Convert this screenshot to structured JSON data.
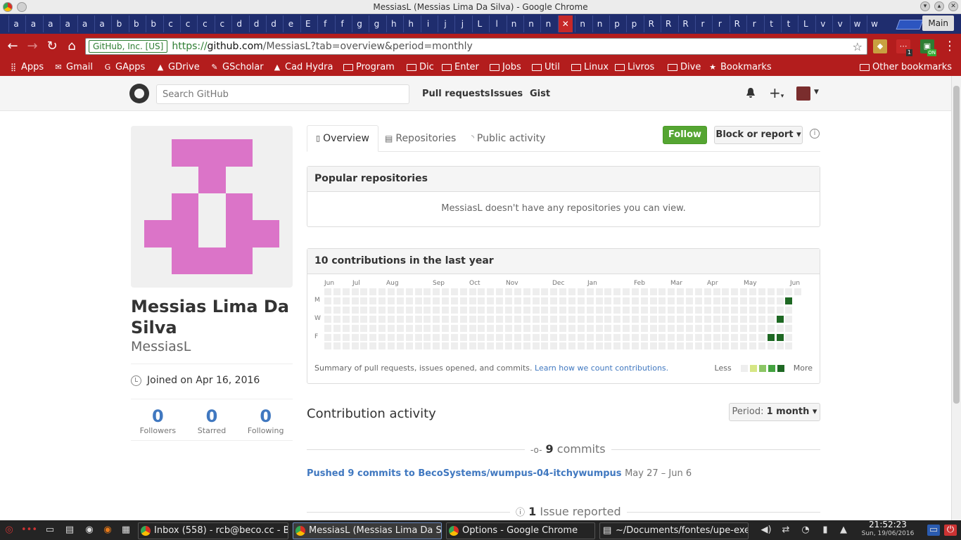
{
  "window": {
    "title": "MessiasL (Messias Lima Da Silva) - Google Chrome"
  },
  "tabstrip": {
    "tabs": [
      "a",
      "a",
      "a",
      "a",
      "a",
      "a",
      "b",
      "b",
      "b",
      "c",
      "c",
      "c",
      "c",
      "d",
      "d",
      "d",
      "e",
      "E",
      "f",
      "f",
      "g",
      "g",
      "h",
      "h",
      "i",
      "j",
      "j",
      "L",
      "l",
      "n",
      "n",
      "n",
      "✕",
      "n",
      "n",
      "p",
      "p",
      "R",
      "R",
      "R",
      "r",
      "r",
      "R",
      "r",
      "t",
      "t",
      "L",
      "v",
      "v",
      "w",
      "w"
    ],
    "active_index": 32,
    "profile": "Main"
  },
  "navbar": {
    "ev_badge": "GitHub, Inc. [US]",
    "url_scheme": "https://",
    "url_host": "github.com",
    "url_path": "/MessiasL?tab=overview&period=monthly",
    "ext_badges": [
      "1",
      "ON"
    ]
  },
  "bookmarks": [
    {
      "label": "Apps",
      "icon": "apps-grid-icon"
    },
    {
      "label": "Gmail",
      "icon": "gmail-icon"
    },
    {
      "label": "GApps",
      "icon": "google-icon"
    },
    {
      "label": "GDrive",
      "icon": "drive-icon"
    },
    {
      "label": "GScholar",
      "icon": "scholar-icon"
    },
    {
      "label": "Cad Hydra",
      "icon": "drive-icon"
    },
    {
      "label": "Program",
      "icon": "folder-icon"
    },
    {
      "label": "Dic",
      "icon": "folder-icon"
    },
    {
      "label": "Enter",
      "icon": "folder-icon"
    },
    {
      "label": "Jobs",
      "icon": "folder-icon"
    },
    {
      "label": "Util",
      "icon": "folder-icon"
    },
    {
      "label": "Linux",
      "icon": "folder-icon"
    },
    {
      "label": "Livros",
      "icon": "folder-icon"
    },
    {
      "label": "Dive",
      "icon": "folder-icon"
    },
    {
      "label": "Bookmarks",
      "icon": "star-icon"
    },
    {
      "label": "Other bookmarks",
      "icon": "folder-icon"
    }
  ],
  "github": {
    "search_placeholder": "Search GitHub",
    "nav": [
      "Pull requests",
      "Issues",
      "Gist"
    ],
    "profile": {
      "fullname": "Messias Lima Da Silva",
      "username": "MessiasL",
      "joined": "Joined on Apr 16, 2016",
      "stats": [
        {
          "num": "0",
          "label": "Followers"
        },
        {
          "num": "0",
          "label": "Starred"
        },
        {
          "num": "0",
          "label": "Following"
        }
      ],
      "identicon_color": "#db74c8"
    },
    "tabs": [
      "Overview",
      "Repositories",
      "Public activity"
    ],
    "follow": "Follow",
    "block": "Block or report ▾",
    "popular": {
      "title": "Popular repositories",
      "message": "MessiasL doesn't have any repositories you can view."
    },
    "contributions": {
      "title": "10 contributions in the last year",
      "months": [
        "Jun",
        "Jul",
        "Aug",
        "Sep",
        "Oct",
        "Nov",
        "Dec",
        "Jan",
        "Feb",
        "Mar",
        "Apr",
        "May",
        "Jun"
      ],
      "days": [
        "M",
        "W",
        "F"
      ],
      "summary": "Summary of pull requests, issues opened, and commits.",
      "learn_link": "Learn how we count contributions.",
      "legend_less": "Less",
      "legend_more": "More",
      "legend_colors": [
        "#eeeeee",
        "#d6e685",
        "#8cc665",
        "#44a340",
        "#1e6823"
      ],
      "active_cells": [
        {
          "week": 51,
          "day": 1,
          "level": 4
        },
        {
          "week": 50,
          "day": 3,
          "level": 4
        },
        {
          "week": 49,
          "day": 5,
          "level": 4
        },
        {
          "week": 50,
          "day": 5,
          "level": 4
        }
      ]
    },
    "activity": {
      "title": "Contribution activity",
      "period_label": "Period:",
      "period_value": "1 month ▾",
      "commits_count": "9",
      "commits_word": "commits",
      "push_text": "Pushed 9 commits to BecoSystems/wumpus-04-itchywumpus",
      "push_date": "May 27 – Jun 6",
      "issues_count": "1",
      "issues_word": "Issue reported"
    }
  },
  "taskbar": {
    "tasks": [
      "Inbox (558) - rcb@beco.cc - B",
      "MessiasL (Messias Lima Da Sil",
      "Options - Google Chrome",
      "~/Documents/fontes/upe-exe"
    ],
    "time": "21:52:23",
    "date": "Sun, 19/06/2016"
  }
}
